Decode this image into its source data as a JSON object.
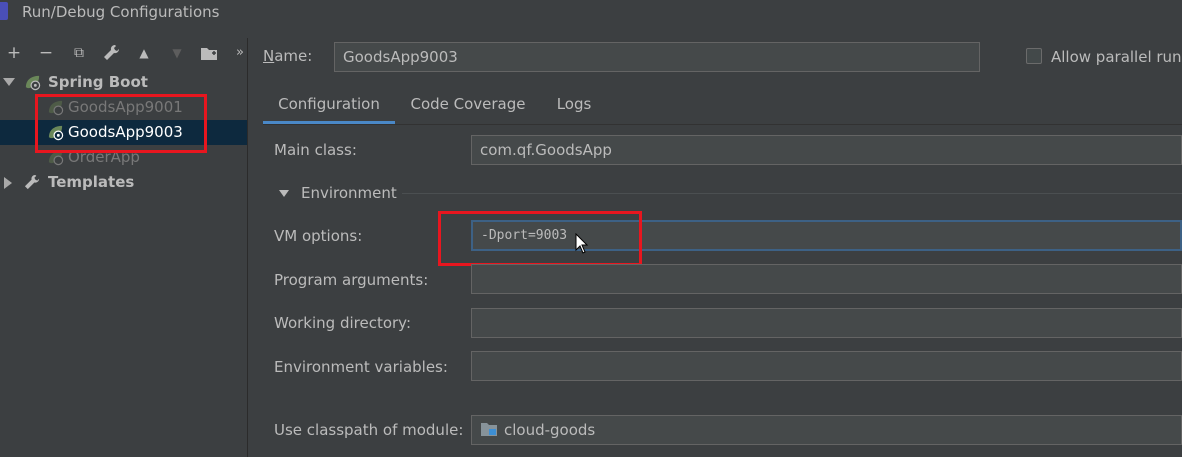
{
  "window": {
    "title": "Run/Debug Configurations"
  },
  "toolbar": {
    "add": "+",
    "remove": "−",
    "copy": "⧉",
    "edit": "🔧",
    "up": "▲",
    "down": "▼",
    "folder": "📁",
    "more": "»"
  },
  "tree": {
    "spring_boot": "Spring Boot",
    "items": [
      {
        "label": "GoodsApp9001",
        "state": "dim"
      },
      {
        "label": "GoodsApp9003",
        "state": "selected"
      },
      {
        "label": "OrderApp",
        "state": "dim"
      }
    ],
    "templates": "Templates"
  },
  "form": {
    "name_label": "Name:",
    "name_value": "GoodsApp9003",
    "allow_parallel": "Allow parallel run",
    "tabs": [
      "Configuration",
      "Code Coverage",
      "Logs"
    ],
    "main_class_label": "Main class:",
    "main_class_value": "com.qf.GoodsApp",
    "environment_label": "Environment",
    "vm_options_label": "VM options:",
    "vm_options_value": "-Dport=9003",
    "program_args_label": "Program arguments:",
    "working_dir_label": "Working directory:",
    "env_vars_label": "Environment variables:",
    "classpath_label": "Use classpath of module:",
    "classpath_value": "cloud-goods"
  },
  "colors": {
    "highlight_red": "#e8161f",
    "selection": "#0d293e",
    "accent": "#4a88c7"
  },
  "icons": [
    "add-icon",
    "remove-icon",
    "copy-icon",
    "wrench-icon",
    "arrow-up-icon",
    "arrow-down-icon",
    "folder-icon",
    "more-icon",
    "spring-boot-icon",
    "module-folder-icon",
    "mouse-cursor-icon"
  ]
}
